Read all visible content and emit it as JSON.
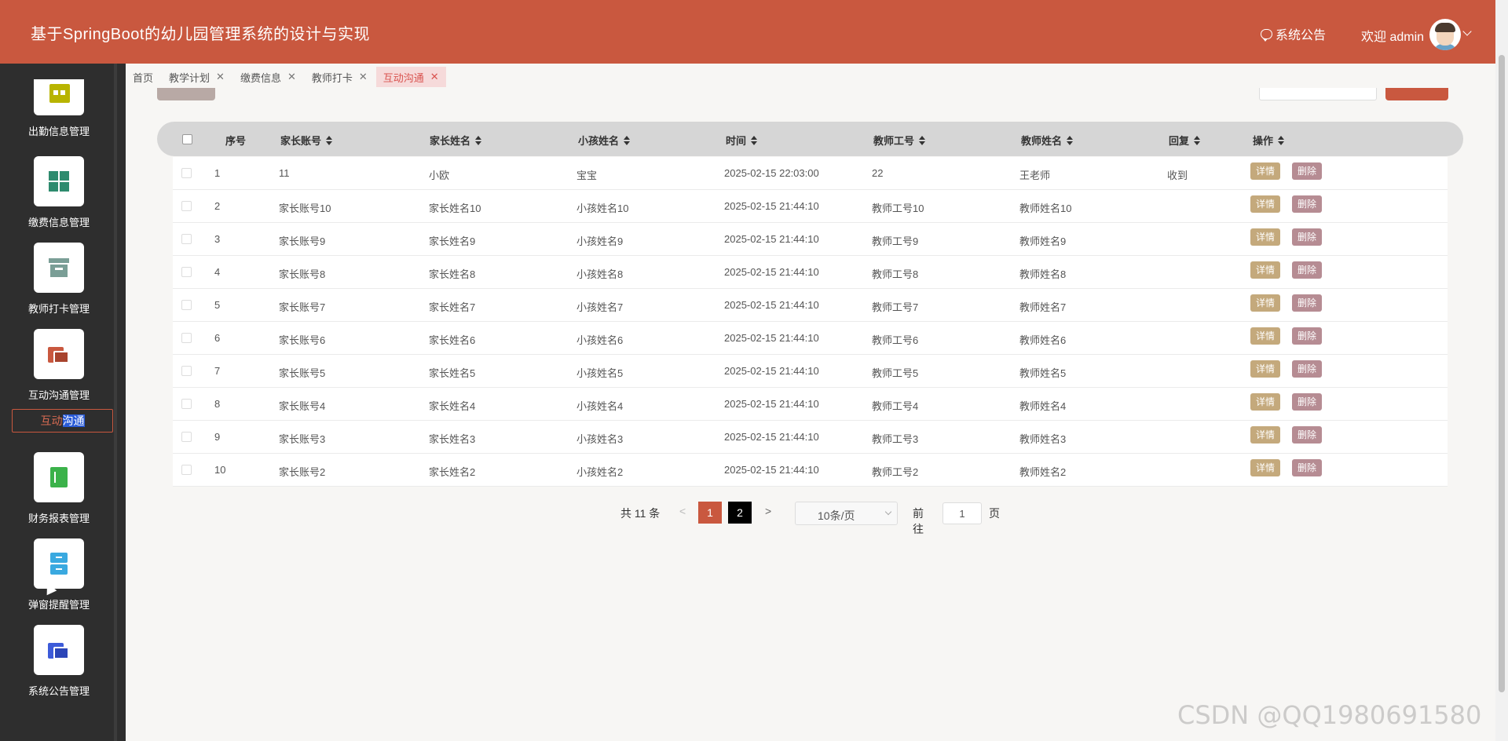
{
  "header": {
    "title": "基于SpringBoot的幼儿园管理系统的设计与实现",
    "notice_label": "系统公告",
    "welcome": "欢迎 admin"
  },
  "sidebar": {
    "items": [
      {
        "label": "出勤信息管理",
        "icon": "calendar-icon",
        "color": "#b8b400"
      },
      {
        "label": "缴费信息管理",
        "icon": "grid-icon",
        "color": "#2e8b6e"
      },
      {
        "label": "教师打卡管理",
        "icon": "archive-icon",
        "color": "#7a9e96"
      },
      {
        "label": "互动沟通管理",
        "icon": "folders-icon",
        "color": "#c9583f"
      },
      {
        "label": "财务报表管理",
        "icon": "book-icon",
        "color": "#3bb24a"
      },
      {
        "label": "弹窗提醒管理",
        "icon": "drawer-icon",
        "color": "#3aa9e0"
      },
      {
        "label": "系统公告管理",
        "icon": "files-icon",
        "color": "#3d5bd9"
      }
    ],
    "subitem": {
      "label_a": "互动",
      "label_b": "沟通"
    }
  },
  "tabs": [
    {
      "label": "首页",
      "closable": false,
      "active": false
    },
    {
      "label": "教学计划",
      "closable": true,
      "active": false
    },
    {
      "label": "缴费信息",
      "closable": true,
      "active": false
    },
    {
      "label": "教师打卡",
      "closable": true,
      "active": false
    },
    {
      "label": "互动沟通",
      "closable": true,
      "active": true
    }
  ],
  "table": {
    "headers": [
      "序号",
      "家长账号",
      "家长姓名",
      "小孩姓名",
      "时间",
      "教师工号",
      "教师姓名",
      "回复",
      "操作"
    ],
    "detail_label": "详情",
    "delete_label": "删除",
    "rows": [
      {
        "index": "1",
        "parent_account": "11",
        "parent_name": "小欧",
        "child_name": "宝宝",
        "time": "2025-02-15 22:03:00",
        "teacher_id": "22",
        "teacher_name": "王老师",
        "reply": "收到"
      },
      {
        "index": "2",
        "parent_account": "家长账号10",
        "parent_name": "家长姓名10",
        "child_name": "小孩姓名10",
        "time": "2025-02-15 21:44:10",
        "teacher_id": "教师工号10",
        "teacher_name": "教师姓名10",
        "reply": ""
      },
      {
        "index": "3",
        "parent_account": "家长账号9",
        "parent_name": "家长姓名9",
        "child_name": "小孩姓名9",
        "time": "2025-02-15 21:44:10",
        "teacher_id": "教师工号9",
        "teacher_name": "教师姓名9",
        "reply": ""
      },
      {
        "index": "4",
        "parent_account": "家长账号8",
        "parent_name": "家长姓名8",
        "child_name": "小孩姓名8",
        "time": "2025-02-15 21:44:10",
        "teacher_id": "教师工号8",
        "teacher_name": "教师姓名8",
        "reply": ""
      },
      {
        "index": "5",
        "parent_account": "家长账号7",
        "parent_name": "家长姓名7",
        "child_name": "小孩姓名7",
        "time": "2025-02-15 21:44:10",
        "teacher_id": "教师工号7",
        "teacher_name": "教师姓名7",
        "reply": ""
      },
      {
        "index": "6",
        "parent_account": "家长账号6",
        "parent_name": "家长姓名6",
        "child_name": "小孩姓名6",
        "time": "2025-02-15 21:44:10",
        "teacher_id": "教师工号6",
        "teacher_name": "教师姓名6",
        "reply": ""
      },
      {
        "index": "7",
        "parent_account": "家长账号5",
        "parent_name": "家长姓名5",
        "child_name": "小孩姓名5",
        "time": "2025-02-15 21:44:10",
        "teacher_id": "教师工号5",
        "teacher_name": "教师姓名5",
        "reply": ""
      },
      {
        "index": "8",
        "parent_account": "家长账号4",
        "parent_name": "家长姓名4",
        "child_name": "小孩姓名4",
        "time": "2025-02-15 21:44:10",
        "teacher_id": "教师工号4",
        "teacher_name": "教师姓名4",
        "reply": ""
      },
      {
        "index": "9",
        "parent_account": "家长账号3",
        "parent_name": "家长姓名3",
        "child_name": "小孩姓名3",
        "time": "2025-02-15 21:44:10",
        "teacher_id": "教师工号3",
        "teacher_name": "教师姓名3",
        "reply": ""
      },
      {
        "index": "10",
        "parent_account": "家长账号2",
        "parent_name": "家长姓名2",
        "child_name": "小孩姓名2",
        "time": "2025-02-15 21:44:10",
        "teacher_id": "教师工号2",
        "teacher_name": "教师姓名2",
        "reply": ""
      }
    ]
  },
  "pagination": {
    "total": "共 11 条",
    "prev": "<",
    "next": ">",
    "pages": [
      "1",
      "2"
    ],
    "current": "1",
    "page_size": "10条/页",
    "goto_label": "前往",
    "goto_value": "1",
    "page_suffix": "页"
  },
  "watermark": "CSDN @QQ1980691580",
  "colors": {
    "header": "#c9583f",
    "sidebar": "#2e2e2e",
    "detail": "#c4a97c",
    "delete": "#b68c93",
    "active_tab_text": "#d9534f"
  }
}
